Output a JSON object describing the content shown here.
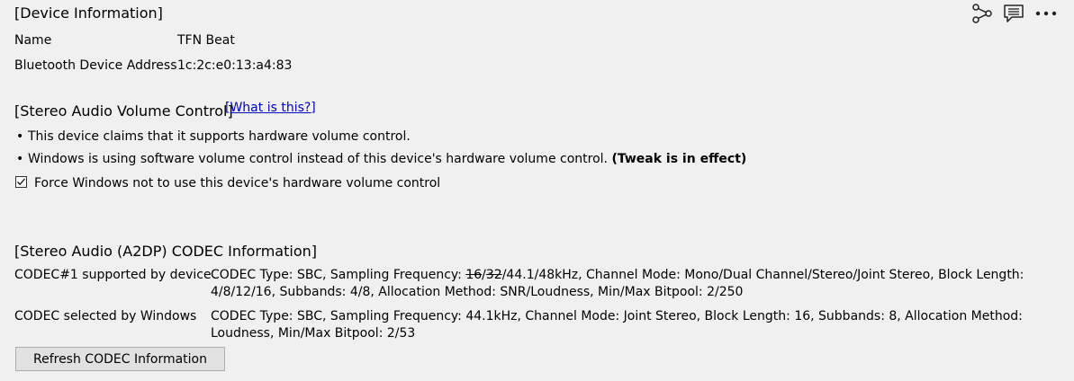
{
  "device_info": {
    "title": "[Device Information]",
    "name_label": "Name",
    "name_value": "TFN Beat",
    "address_label": "Bluetooth Device Address",
    "address_value": "1c:2c:e0:13:a4:83"
  },
  "volume": {
    "title": "[Stereo Audio Volume Control]",
    "what_link": "[What is this?]",
    "bullet1": "This device claims that it supports hardware volume control.",
    "bullet2": "Windows is using software volume control instead of this device's hardware volume control.",
    "bullet2_bold": "(Tweak is in effect)",
    "checkbox_label": "Force Windows not to use this device's hardware volume control",
    "checkbox_checked": true
  },
  "codec": {
    "title": "[Stereo Audio (A2DP) CODEC Information]",
    "row1_label": "CODEC#1 supported by device",
    "row1_pre": "CODEC Type: SBC, Sampling Frequency: ",
    "row1_strike1": "16",
    "row1_sep1": "/",
    "row1_strike2": "32",
    "row1_post": "/44.1/48kHz, Channel Mode: Mono/Dual Channel/Stereo/Joint Stereo, Block Length: 4/8/12/16, Subbands: 4/8, Allocation Method: SNR/Loudness, Min/Max Bitpool: 2/250",
    "row2_label": "CODEC selected by Windows",
    "row2_value": "CODEC Type: SBC, Sampling Frequency: 44.1kHz, Channel Mode: Joint Stereo, Block Length: 16, Subbands: 8, Allocation Method: Loudness, Min/Max Bitpool: 2/53",
    "refresh_button": "Refresh CODEC Information"
  },
  "toolbar": {
    "icons": [
      "share-icon",
      "comment-icon",
      "more-icon"
    ]
  }
}
